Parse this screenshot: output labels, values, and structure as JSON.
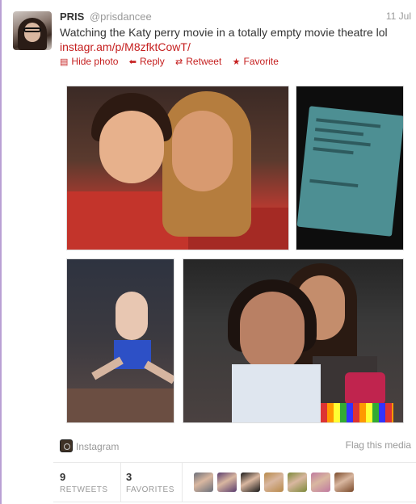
{
  "tweet": {
    "fullname": "PRIS",
    "username": "@prisdancee",
    "time": "11 Jul",
    "text": "Watching the Katy perry movie in a totally empty movie theatre lol",
    "link": "instagr.am/p/M8zfktCowT/"
  },
  "actions": [
    {
      "label": "Hide photo",
      "icon": "photo-icon"
    },
    {
      "label": "Reply",
      "icon": "reply-arrow-icon"
    },
    {
      "label": "Retweet",
      "icon": "retweet-icon"
    },
    {
      "label": "Favorite",
      "icon": "star-icon"
    }
  ],
  "media": {
    "source": "Instagram",
    "flag": "Flag this media"
  },
  "stats": {
    "retweets_count": "9",
    "retweets_label": "RETWEETS",
    "favorites_count": "3",
    "favorites_label": "FAVORITES"
  },
  "colors": {
    "link": "#c51f1f",
    "muted": "#999999",
    "text": "#333333"
  },
  "favoriters_thumb_colors": [
    "#6b6f7a",
    "#5a3d6e",
    "#1a1a1a",
    "#b88a4a",
    "#7d8a3a",
    "#c07aa0",
    "#7a4a2a"
  ]
}
